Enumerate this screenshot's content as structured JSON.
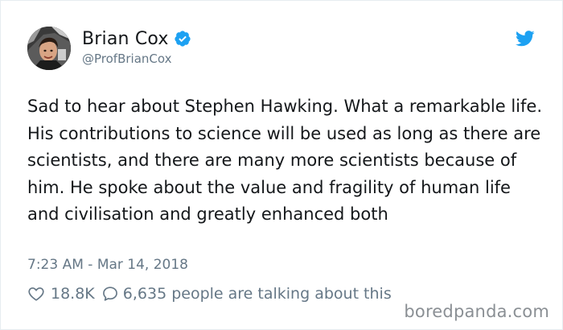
{
  "author": {
    "display_name": "Brian Cox",
    "handle": "@ProfBrianCox",
    "verified": true
  },
  "tweet": {
    "text": "Sad to hear about Stephen Hawking. What a remarkable life. His contributions to science will be used as long as there are scientists, and there are many more scientists because of him. He spoke about the value and fragility of human life and civilisation and greatly enhanced both",
    "timestamp": "7:23 AM - Mar 14, 2018"
  },
  "engagement": {
    "likes": "18.8K",
    "talking": "6,635 people are talking about this"
  },
  "watermark": "boredpanda.com",
  "colors": {
    "twitter_blue": "#1da1f2",
    "text_primary": "#14171a",
    "text_secondary": "#657786"
  },
  "icons": {
    "verified": "verified-badge-icon",
    "brand": "twitter-bird-icon",
    "like": "heart-icon",
    "reply": "comment-icon"
  }
}
